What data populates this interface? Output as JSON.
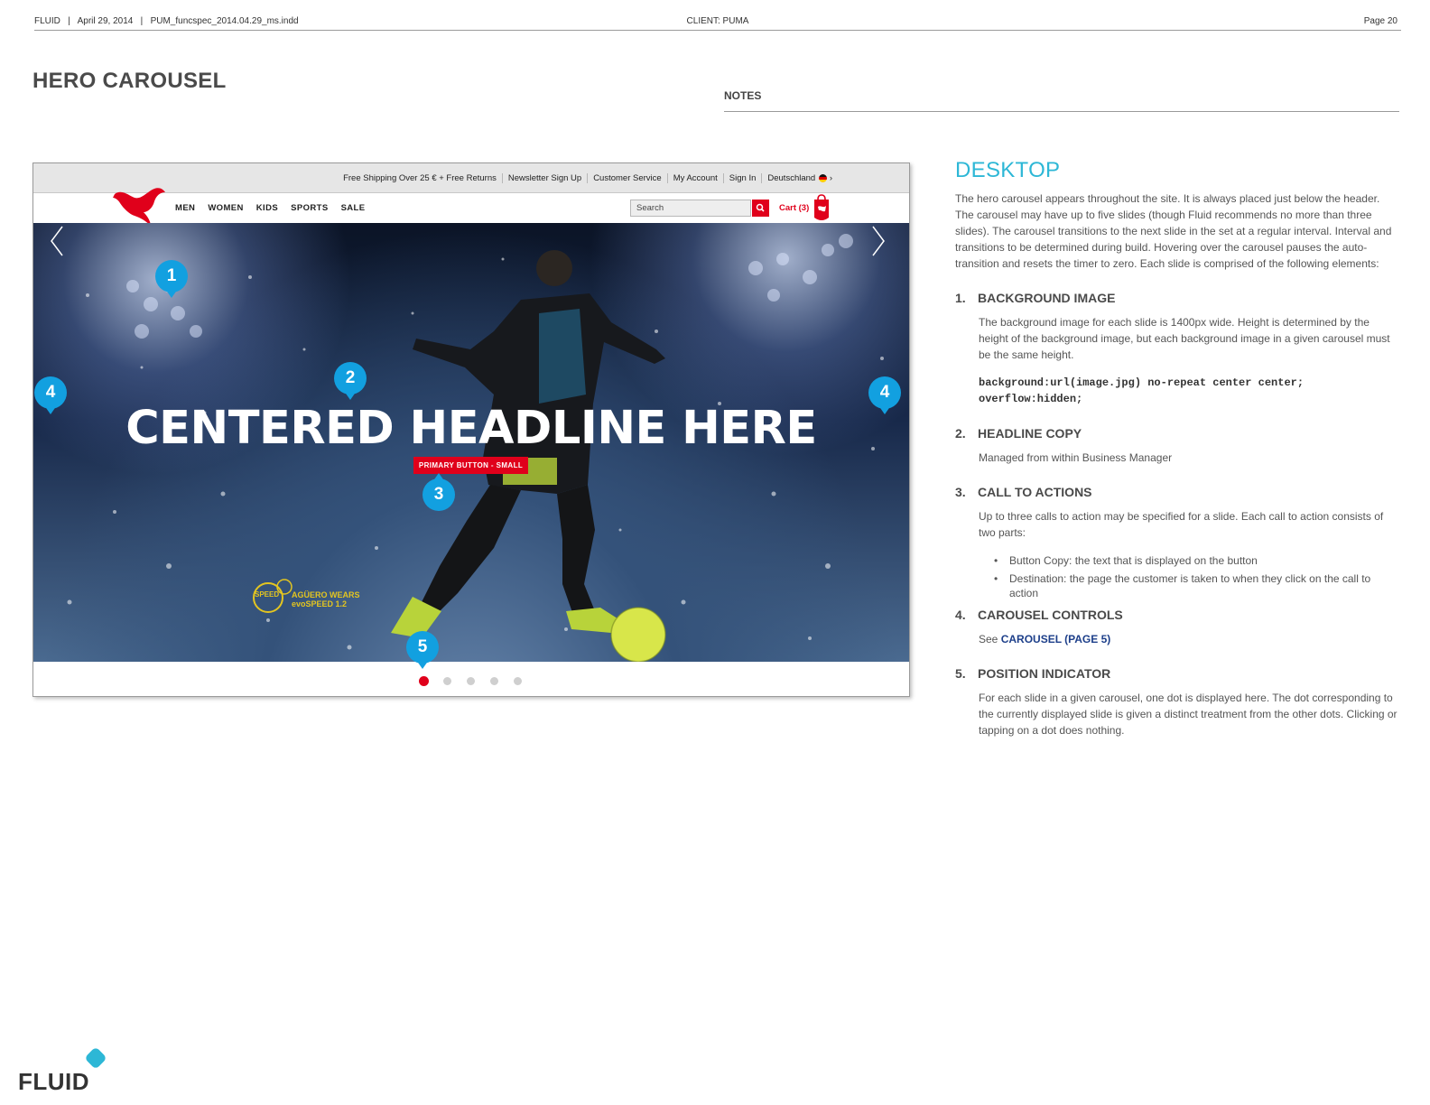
{
  "running_header": {
    "left": "FLUID   |   April 29, 2014   |   PUM_funcspec_2014.04.29_ms.indd",
    "center": "CLIENT: PUMA",
    "right": "Page 20"
  },
  "page_title": "HERO CAROUSEL",
  "notes_label": "NOTES",
  "mockup": {
    "utility_links": [
      "Free Shipping Over 25 € + Free Returns",
      "Newsletter Sign Up",
      "Customer Service",
      "My Account",
      "Sign In",
      "Deutschland"
    ],
    "nav_items": [
      "MEN",
      "WOMEN",
      "KIDS",
      "SPORTS",
      "SALE"
    ],
    "search_placeholder": "Search",
    "cart_label": "Cart (3)",
    "headline": "CENTERED HEADLINE HERE",
    "cta_label": "PRIMARY BUTTON - SMALL",
    "promo_badge": "SPEED",
    "promo_line1": "AGÜERO WEARS",
    "promo_line2": "evoSPEED 1.2",
    "slide_count": 5,
    "active_slide": 1,
    "markers": [
      "1",
      "2",
      "3",
      "4",
      "4",
      "5"
    ]
  },
  "notes": {
    "heading": "DESKTOP",
    "intro": "The hero carousel appears throughout the site. It is always placed just below the header. The carousel may have up to five slides (though Fluid recommends no more than three slides). The carousel transitions to the next slide in the set at a regular interval. Interval and transitions to be determined during build. Hovering over the carousel pauses the auto-transition and resets the timer to zero. Each slide is comprised of the following elements:",
    "items": [
      {
        "num": "1.",
        "title": "BACKGROUND IMAGE",
        "body": "The background image for each slide is 1400px wide. Height is determined by the height of the background image, but each background image in a given carousel must be the same height.",
        "code_line1": "background:url(image.jpg) no-repeat center center;",
        "code_line2": "overflow:hidden;"
      },
      {
        "num": "2.",
        "title": "HEADLINE COPY",
        "body": "Managed from within Business Manager"
      },
      {
        "num": "3.",
        "title": "CALL TO ACTIONS",
        "body": "Up to three calls to action may be specified for a slide. Each call to action consists of two parts:",
        "bullets": [
          "Button Copy: the text that is displayed on the button",
          "Destination: the page the customer is taken to when they click on the call to action"
        ]
      },
      {
        "num": "4.",
        "title": "CAROUSEL CONTROLS",
        "see_prefix": "See",
        "see_link": "CAROUSEL (PAGE 5)"
      },
      {
        "num": "5.",
        "title": "POSITION INDICATOR",
        "body": "For each slide in a given carousel, one dot is displayed here. The dot corresponding to the currently displayed slide is given a distinct treatment from the other dots. Clicking or tapping on a dot does nothing."
      }
    ]
  },
  "footer_logo": "FLUID",
  "colors": {
    "accent_cyan": "#2db7d6",
    "marker_blue": "#12a0e0",
    "puma_red": "#e0001b",
    "link_blue": "#1d3f8a"
  }
}
